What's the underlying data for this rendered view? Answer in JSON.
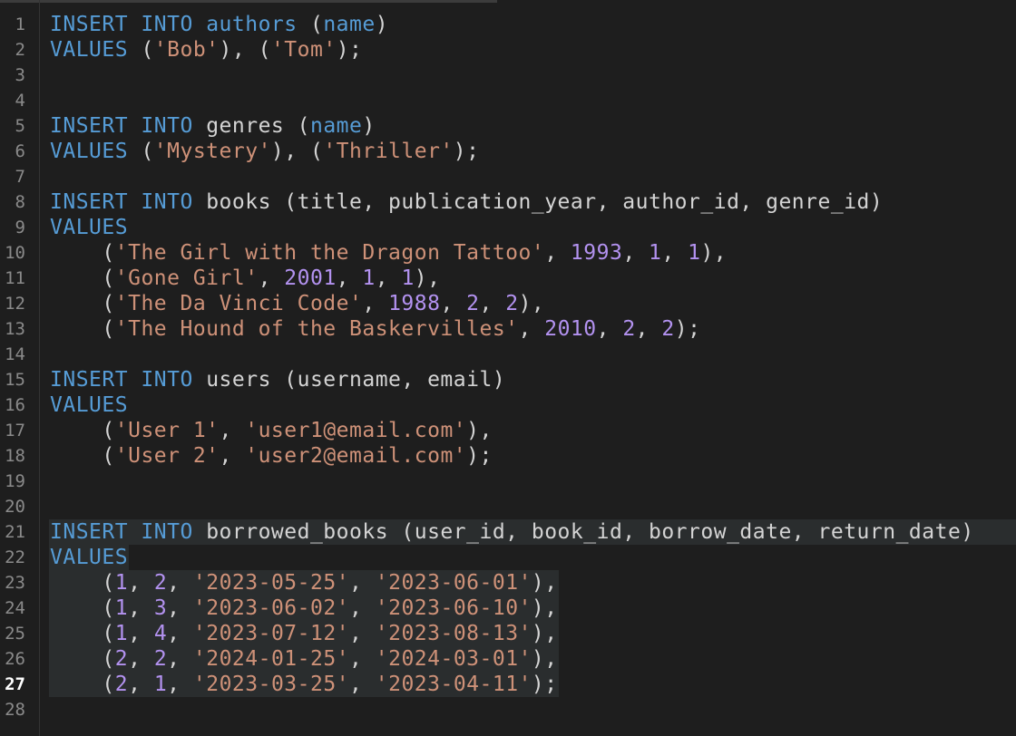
{
  "editor": {
    "active_line": 27,
    "lines": [
      {
        "n": "1",
        "tokens": [
          [
            "k",
            "INSERT INTO"
          ],
          [
            "p",
            " "
          ],
          [
            "k",
            "authors"
          ],
          [
            "p",
            " ("
          ],
          [
            "k",
            "name"
          ],
          [
            "p",
            ")"
          ]
        ]
      },
      {
        "n": "2",
        "tokens": [
          [
            "k",
            "VALUES"
          ],
          [
            "p",
            " ("
          ],
          [
            "s",
            "'Bob'"
          ],
          [
            "p",
            "), ("
          ],
          [
            "s",
            "'Tom'"
          ],
          [
            "p",
            ");"
          ]
        ]
      },
      {
        "n": "3",
        "tokens": []
      },
      {
        "n": "4",
        "tokens": []
      },
      {
        "n": "5",
        "tokens": [
          [
            "k",
            "INSERT INTO"
          ],
          [
            "p",
            " "
          ],
          [
            "i",
            "genres"
          ],
          [
            "p",
            " ("
          ],
          [
            "k",
            "name"
          ],
          [
            "p",
            ")"
          ]
        ]
      },
      {
        "n": "6",
        "tokens": [
          [
            "k",
            "VALUES"
          ],
          [
            "p",
            " ("
          ],
          [
            "s",
            "'Mystery'"
          ],
          [
            "p",
            "), ("
          ],
          [
            "s",
            "'Thriller'"
          ],
          [
            "p",
            ");"
          ]
        ]
      },
      {
        "n": "7",
        "tokens": []
      },
      {
        "n": "8",
        "tokens": [
          [
            "k",
            "INSERT INTO"
          ],
          [
            "p",
            " "
          ],
          [
            "i",
            "books (title, publication_year, author_id, genre_id)"
          ]
        ]
      },
      {
        "n": "9",
        "tokens": [
          [
            "k",
            "VALUES"
          ]
        ]
      },
      {
        "n": "10",
        "tokens": [
          [
            "p",
            "    ("
          ],
          [
            "s",
            "'The Girl with the Dragon Tattoo'"
          ],
          [
            "p",
            ", "
          ],
          [
            "n",
            "1993"
          ],
          [
            "p",
            ", "
          ],
          [
            "n",
            "1"
          ],
          [
            "p",
            ", "
          ],
          [
            "n",
            "1"
          ],
          [
            "p",
            "),"
          ]
        ]
      },
      {
        "n": "11",
        "tokens": [
          [
            "p",
            "    ("
          ],
          [
            "s",
            "'Gone Girl'"
          ],
          [
            "p",
            ", "
          ],
          [
            "n",
            "2001"
          ],
          [
            "p",
            ", "
          ],
          [
            "n",
            "1"
          ],
          [
            "p",
            ", "
          ],
          [
            "n",
            "1"
          ],
          [
            "p",
            "),"
          ]
        ]
      },
      {
        "n": "12",
        "tokens": [
          [
            "p",
            "    ("
          ],
          [
            "s",
            "'The Da Vinci Code'"
          ],
          [
            "p",
            ", "
          ],
          [
            "n",
            "1988"
          ],
          [
            "p",
            ", "
          ],
          [
            "n",
            "2"
          ],
          [
            "p",
            ", "
          ],
          [
            "n",
            "2"
          ],
          [
            "p",
            "),"
          ]
        ]
      },
      {
        "n": "13",
        "tokens": [
          [
            "p",
            "    ("
          ],
          [
            "s",
            "'The Hound of the Baskervilles'"
          ],
          [
            "p",
            ", "
          ],
          [
            "n",
            "2010"
          ],
          [
            "p",
            ", "
          ],
          [
            "n",
            "2"
          ],
          [
            "p",
            ", "
          ],
          [
            "n",
            "2"
          ],
          [
            "p",
            ");"
          ]
        ]
      },
      {
        "n": "14",
        "tokens": []
      },
      {
        "n": "15",
        "tokens": [
          [
            "k",
            "INSERT INTO"
          ],
          [
            "p",
            " "
          ],
          [
            "i",
            "users (username, email)"
          ]
        ]
      },
      {
        "n": "16",
        "tokens": [
          [
            "k",
            "VALUES"
          ]
        ]
      },
      {
        "n": "17",
        "tokens": [
          [
            "p",
            "    ("
          ],
          [
            "s",
            "'User 1'"
          ],
          [
            "p",
            ", "
          ],
          [
            "s",
            "'user1@email.com'"
          ],
          [
            "p",
            "),"
          ]
        ]
      },
      {
        "n": "18",
        "tokens": [
          [
            "p",
            "    ("
          ],
          [
            "s",
            "'User 2'"
          ],
          [
            "p",
            ", "
          ],
          [
            "s",
            "'user2@email.com'"
          ],
          [
            "p",
            ");"
          ]
        ]
      },
      {
        "n": "19",
        "tokens": []
      },
      {
        "n": "20",
        "tokens": []
      },
      {
        "n": "21",
        "tokens": [
          [
            "k",
            "INSERT INTO"
          ],
          [
            "p",
            " "
          ],
          [
            "i",
            "borrowed_books (user_id, book_id, borrow_date, return_date)"
          ]
        ]
      },
      {
        "n": "22",
        "tokens": [
          [
            "k",
            "VALUES"
          ]
        ]
      },
      {
        "n": "23",
        "tokens": [
          [
            "p",
            "    ("
          ],
          [
            "n",
            "1"
          ],
          [
            "p",
            ", "
          ],
          [
            "n",
            "2"
          ],
          [
            "p",
            ", "
          ],
          [
            "s",
            "'2023-05-25'"
          ],
          [
            "p",
            ", "
          ],
          [
            "s",
            "'2023-06-01'"
          ],
          [
            "p",
            "),"
          ]
        ]
      },
      {
        "n": "24",
        "tokens": [
          [
            "p",
            "    ("
          ],
          [
            "n",
            "1"
          ],
          [
            "p",
            ", "
          ],
          [
            "n",
            "3"
          ],
          [
            "p",
            ", "
          ],
          [
            "s",
            "'2023-06-02'"
          ],
          [
            "p",
            ", "
          ],
          [
            "s",
            "'2023-06-10'"
          ],
          [
            "p",
            "),"
          ]
        ]
      },
      {
        "n": "25",
        "tokens": [
          [
            "p",
            "    ("
          ],
          [
            "n",
            "1"
          ],
          [
            "p",
            ", "
          ],
          [
            "n",
            "4"
          ],
          [
            "p",
            ", "
          ],
          [
            "s",
            "'2023-07-12'"
          ],
          [
            "p",
            ", "
          ],
          [
            "s",
            "'2023-08-13'"
          ],
          [
            "p",
            "),"
          ]
        ]
      },
      {
        "n": "26",
        "tokens": [
          [
            "p",
            "    ("
          ],
          [
            "n",
            "2"
          ],
          [
            "p",
            ", "
          ],
          [
            "n",
            "2"
          ],
          [
            "p",
            ", "
          ],
          [
            "s",
            "'2024-01-25'"
          ],
          [
            "p",
            ", "
          ],
          [
            "s",
            "'2024-03-01'"
          ],
          [
            "p",
            "),"
          ]
        ]
      },
      {
        "n": "27",
        "tokens": [
          [
            "p",
            "    ("
          ],
          [
            "n",
            "2"
          ],
          [
            "p",
            ", "
          ],
          [
            "n",
            "1"
          ],
          [
            "p",
            ", "
          ],
          [
            "s",
            "'2023-03-25'"
          ],
          [
            "p",
            ", "
          ],
          [
            "s",
            "'2023-04-11'"
          ],
          [
            "p",
            ");"
          ]
        ]
      },
      {
        "n": "28",
        "tokens": []
      }
    ],
    "selected_lines": [
      21,
      22,
      23,
      24,
      25,
      26,
      27
    ],
    "colors": {
      "keyword": "#569cd6",
      "string": "#ce9178",
      "number": "#b392f0",
      "background": "#1e1e1e",
      "selection": "#2a2d2e"
    }
  }
}
